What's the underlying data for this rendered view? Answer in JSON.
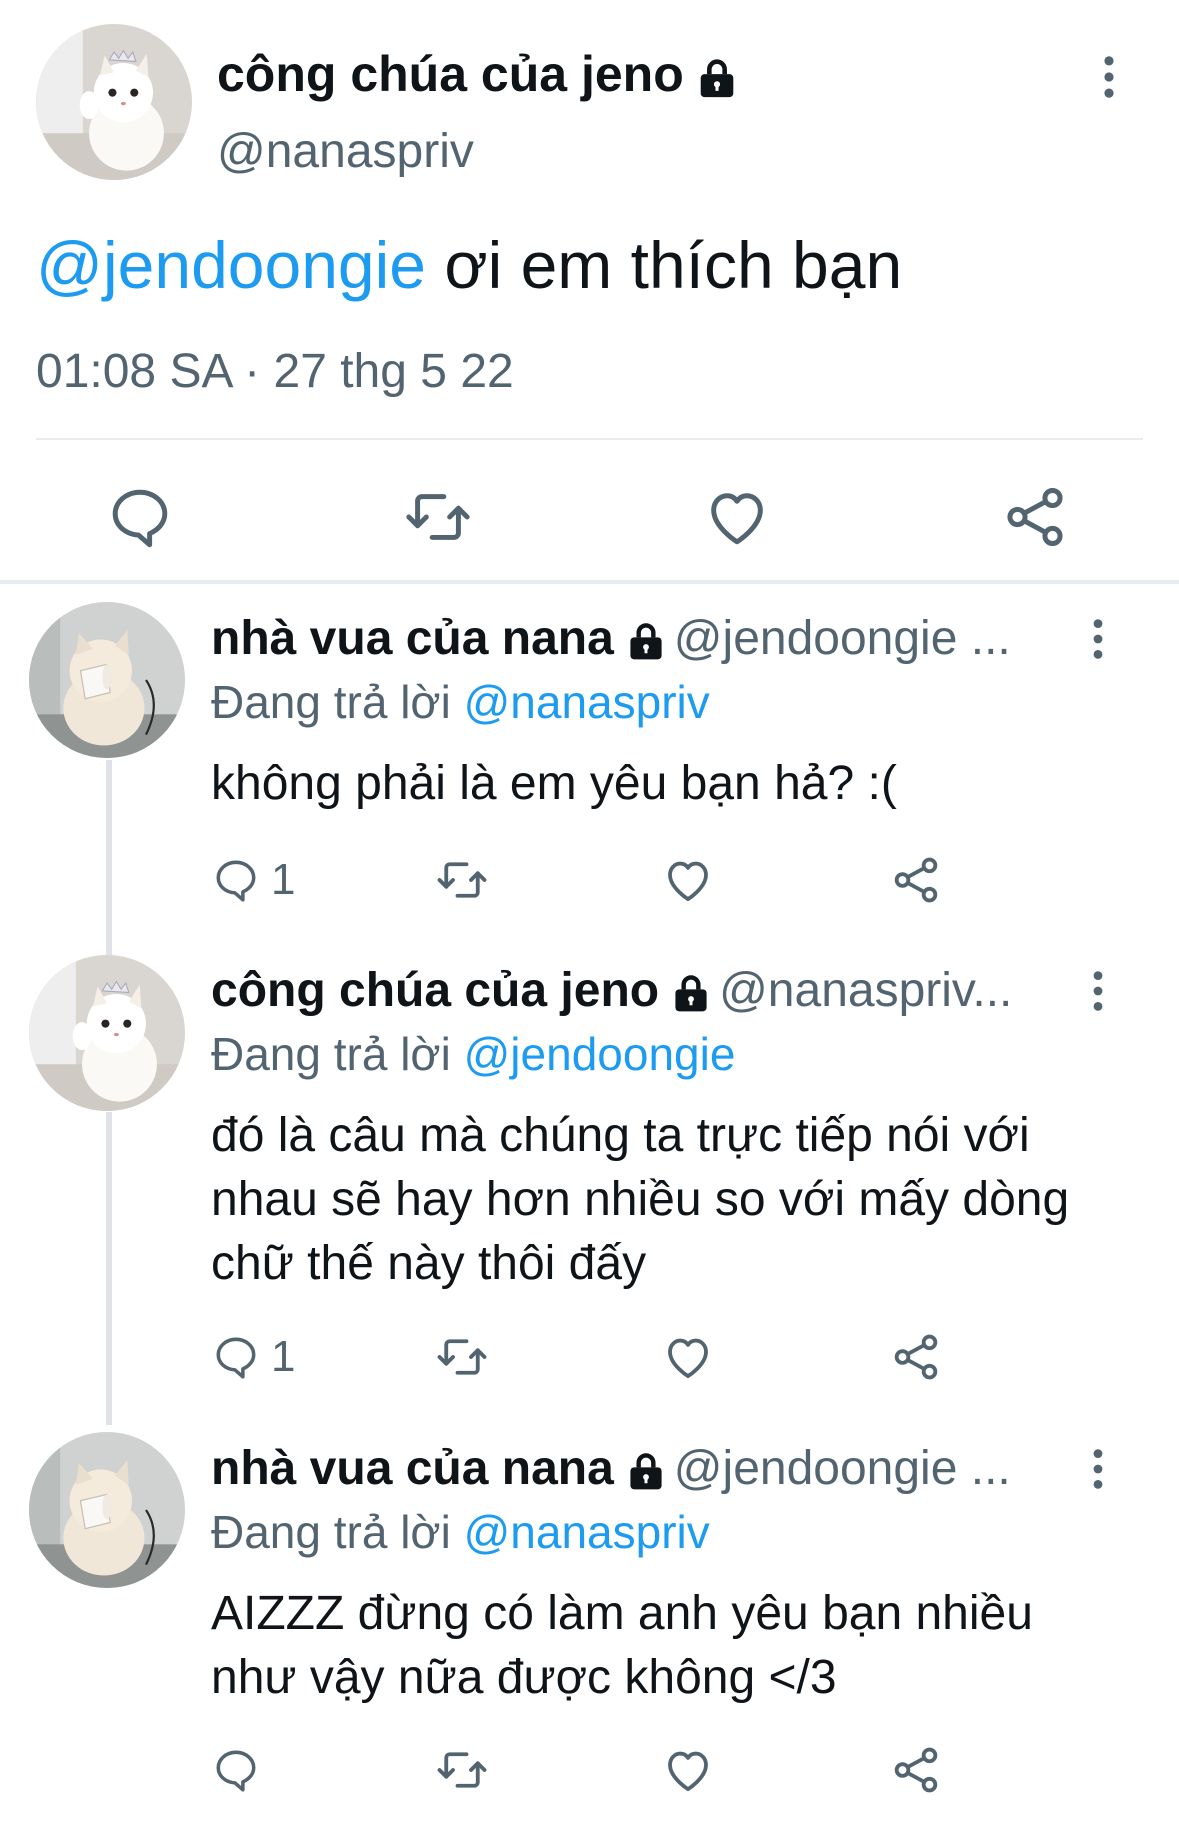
{
  "main_tweet": {
    "author_name": "công chúa của jeno",
    "handle": "@nanaspriv",
    "mention": "@jendoongie",
    "text": " ơi em thích bạn",
    "timestamp": "01:08 SA · 27 thg 5 22",
    "actions": [
      "reply-icon",
      "retweet-icon",
      "like-icon",
      "share-icon"
    ]
  },
  "replies": [
    {
      "author_name": "nhà vua của nana",
      "handle": "@jendoongie ...",
      "replying_prefix": "Đang trả lời",
      "replying_to": "@nanaspriv",
      "text": "không phải là em yêu bạn hả? :(",
      "reply_count": "1"
    },
    {
      "author_name": "công chúa của jeno",
      "handle": "@nanaspriv...",
      "replying_prefix": "Đang trả lời",
      "replying_to": "@jendoongie",
      "text": "đó là câu mà chúng ta trực tiếp nói với nhau sẽ hay hơn nhiều so với mấy dòng chữ thế này thôi đấy",
      "reply_count": "1"
    },
    {
      "author_name": "nhà vua của nana",
      "handle": "@jendoongie ...",
      "replying_prefix": "Đang trả lời",
      "replying_to": "@nanaspriv",
      "text": "AIZZZ đừng có làm anh yêu bạn nhiều như vậy nữa được không </3",
      "reply_count": ""
    }
  ],
  "colors": {
    "accent": "#1d9bf0",
    "secondary_text": "#536471",
    "divider": "#e6ecf0"
  }
}
